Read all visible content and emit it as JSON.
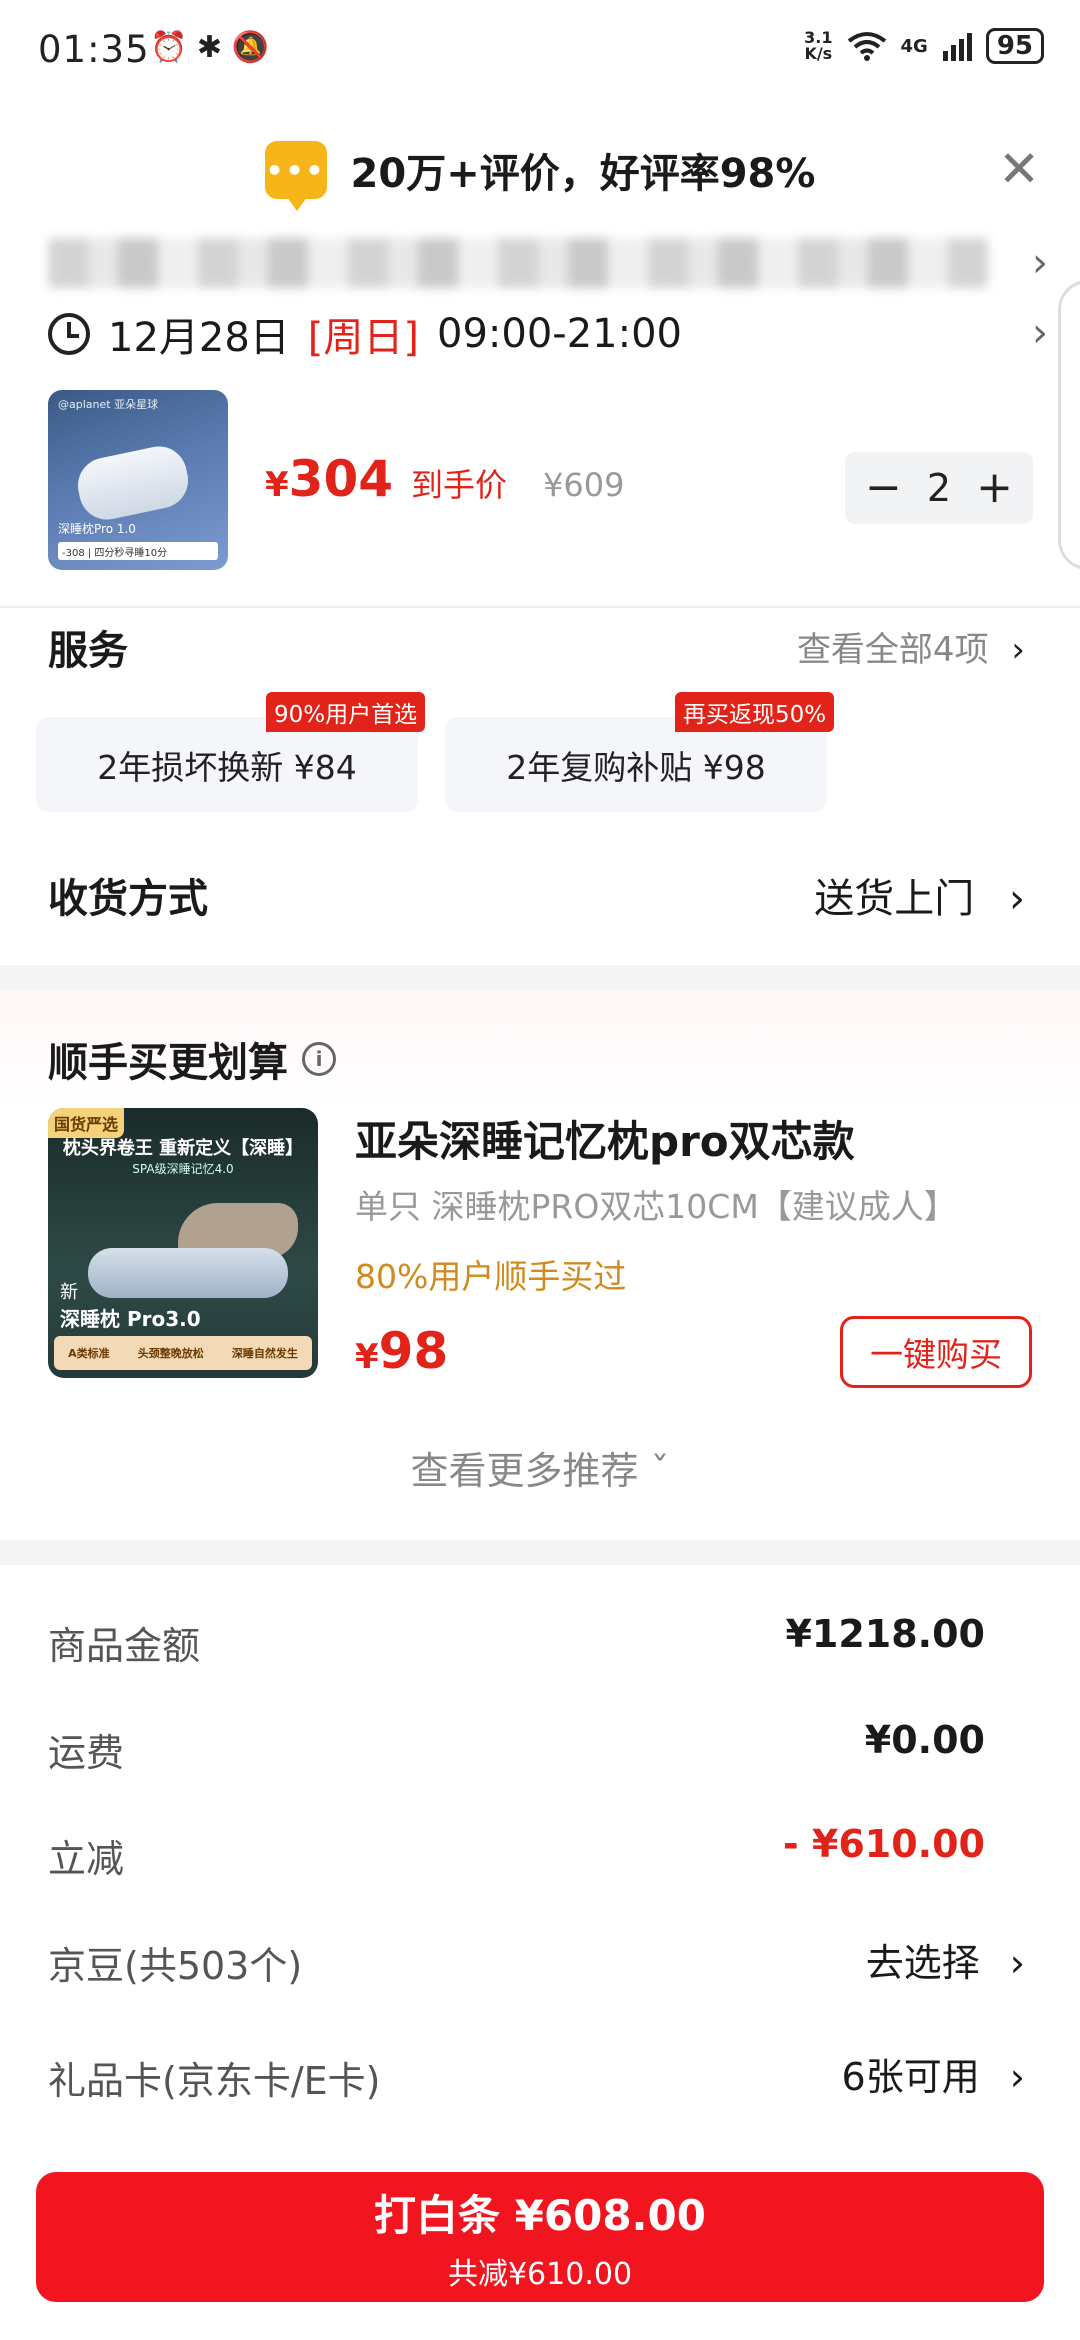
{
  "status_bar": {
    "time": "01:35",
    "left_icons": "⏰ ✱ 🔕",
    "net_speed_top": "3.1",
    "net_speed_bottom": "K/s",
    "network": "4G",
    "battery": "95"
  },
  "review_banner": {
    "icon": "chat-bubble-icon",
    "text": "20万+评价，好评率98%"
  },
  "delivery": {
    "date": "12月28日",
    "weekday": "[周日]",
    "time_range": "09:00-21:00"
  },
  "product": {
    "thumb_brand": "@aplanet 亚朵星球",
    "thumb_label": "深睡枕Pro 1.0",
    "thumb_tags": "-308 | 四分秒寻睡10分",
    "price_symbol": "¥",
    "price": "304",
    "price_tag": "到手价",
    "original_price": "¥609",
    "quantity": "2",
    "minus_label": "−",
    "plus_label": "+"
  },
  "service": {
    "title": "服务",
    "view_all": "查看全部4项",
    "items": [
      {
        "label": "2年损坏换新  ¥84",
        "badge": "90%用户首选"
      },
      {
        "label": "2年复购补贴  ¥98",
        "badge": "再买返现50%"
      }
    ]
  },
  "receive": {
    "title": "收货方式",
    "value": "送货上门"
  },
  "upsell": {
    "title": "顺手买更划算",
    "thumb_badge": "国货严选",
    "thumb_headline": "枕头界卷王 重新定义【深睡】",
    "thumb_sub": "SPA级深睡记忆4.0",
    "thumb_new": "新",
    "thumb_name": "深睡枕 Pro3.0",
    "thumb_strip": [
      "A类标准",
      "头颈整晚放松",
      "深睡自然发生"
    ],
    "name": "亚朵深睡记忆枕pro双芯款",
    "desc": "单只 深睡枕PRO双芯10CM【建议成人】",
    "ratio": "80%用户顺手买过",
    "price_symbol": "¥",
    "price": "98",
    "buy_label": "一键购买",
    "more": "查看更多推荐 ˇ"
  },
  "summary": {
    "rows": [
      {
        "label": "商品金额",
        "value": "¥1218.00"
      },
      {
        "label": "运费",
        "value": "¥0.00"
      },
      {
        "label": "立减",
        "value": "- ¥610.00"
      },
      {
        "label": "京豆(共503个)",
        "value": "去选择"
      },
      {
        "label": "礼品卡(京东卡/E卡)",
        "value": "6张可用"
      }
    ]
  },
  "pay": {
    "main": "打白条 ¥608.00",
    "sub": "共减¥610.00"
  },
  "chevron": "›",
  "colors": {
    "accent_red": "#e2231a",
    "pay_red": "#f2151f",
    "ratio_orange": "#d08a1e"
  }
}
